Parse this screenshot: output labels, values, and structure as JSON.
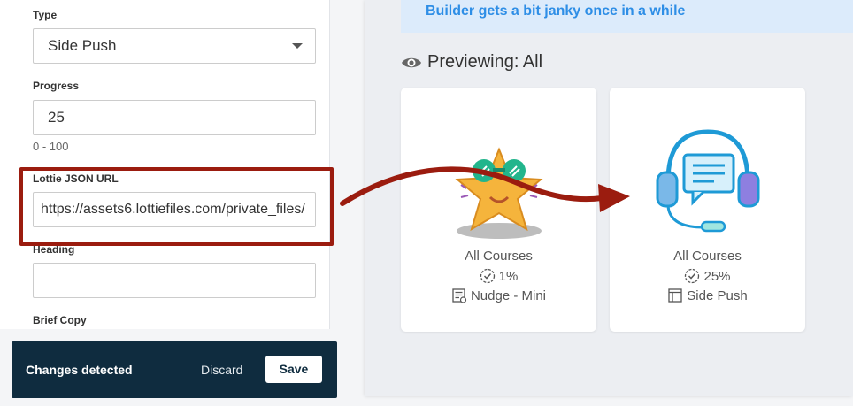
{
  "form": {
    "type_label": "Type",
    "type_value": "Side Push",
    "progress_label": "Progress",
    "progress_value": "25",
    "progress_hint": "0 - 100",
    "lottie_label": "Lottie JSON URL",
    "lottie_value": "https://assets6.lottiefiles.com/private_files/",
    "heading_label": "Heading",
    "heading_value": "",
    "brief_label": "Brief Copy"
  },
  "changes": {
    "message": "Changes detected",
    "discard_label": "Discard",
    "save_label": "Save"
  },
  "preview": {
    "banner_text": "Builder gets a bit janky once in a while",
    "heading": "Previewing: All",
    "cards": [
      {
        "title": "All Courses",
        "progress": "1%",
        "type": "Nudge - Mini",
        "illustration": "star-with-sunglasses"
      },
      {
        "title": "All Courses",
        "progress": "25%",
        "type": "Side Push",
        "illustration": "headset-chat"
      }
    ]
  },
  "colors": {
    "highlight": "#9b1c0f",
    "bar": "#0f2c3f",
    "banner_bg": "#dcebfb",
    "banner_text": "#2e8ee6"
  }
}
